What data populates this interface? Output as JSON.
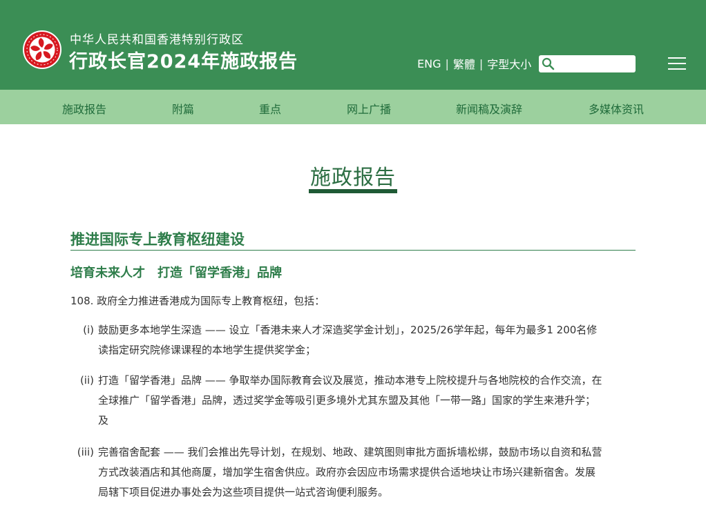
{
  "header": {
    "subtitle": "中华人民共和国香港特别行政区",
    "title": "行政长官2024年施政报告",
    "emblem_icon": "hksar-emblem-icon",
    "colors": {
      "header_bg": "#3b8e55",
      "nav_bg": "#9cd09e",
      "accent": "#2e7d4a"
    }
  },
  "tools": {
    "lang_en": "ENG",
    "lang_tc": "繁體",
    "font_size": "字型大小",
    "search_placeholder": "",
    "menu_icon": "hamburger-menu-icon"
  },
  "nav": {
    "items": [
      {
        "label": "施政报告"
      },
      {
        "label": "附篇"
      },
      {
        "label": "重点"
      },
      {
        "label": "网上广播"
      },
      {
        "label": "新闻稿及演辞"
      },
      {
        "label": "多媒体资讯"
      }
    ]
  },
  "main": {
    "page_title": "施政报告",
    "section_heading": "推进国际专上教育枢纽建设",
    "sub_heading": "培育未来人才　打造「留学香港」品牌",
    "paragraph": "108. 政府全力推进香港成为国际专上教育枢纽，包括：",
    "items": [
      {
        "num": "(i)",
        "lines": [
          "鼓励更多本地学生深造 —— 设立「香港未来人才深造奖学金计划」，2025/26学年起，每年为最多1 200名修",
          "读指定研究院修课课程的本地学生提供奖学金；"
        ]
      },
      {
        "num": "(ii)",
        "lines": [
          "打造「留学香港」品牌 —— 争取举办国际教育会议及展览，推动本港专上院校提升与各地院校的合作交流，在",
          "全球推广「留学香港」品牌，透过奖学金等吸引更多境外尤其东盟及其他「一带一路」国家的学生来港升学；",
          "及"
        ]
      },
      {
        "num": "(iii)",
        "lines": [
          "完善宿舍配套 —— 我们会推出先导计划，在规划、地政、建筑图则审批方面拆墙松绑，鼓励市场以自资和私营",
          "方式改装酒店和其他商厦，增加学生宿舍供应。政府亦会因应市场需求提供合适地块让市场兴建新宿舍。发展",
          "局辖下项目促进办事处会为这些项目提供一站式咨询便利服务。"
        ]
      }
    ]
  }
}
